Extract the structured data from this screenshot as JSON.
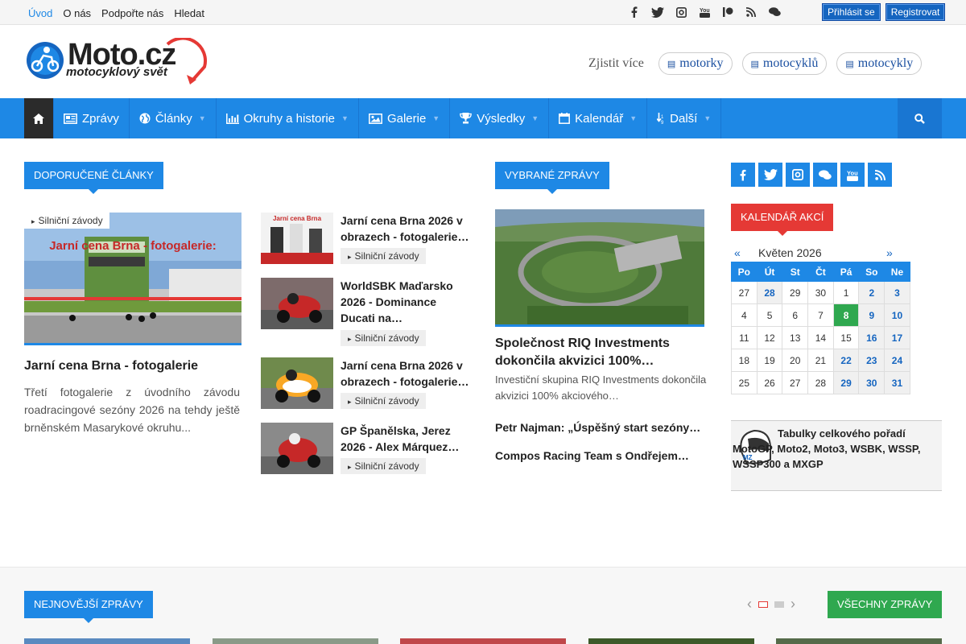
{
  "topbar": {
    "nav": [
      "Úvod",
      "O nás",
      "Podpořte nás",
      "Hledat"
    ],
    "social_icons": [
      "facebook-icon",
      "twitter-icon",
      "instagram-icon",
      "youtube-icon",
      "patreon-icon",
      "rss-icon",
      "forum-icon"
    ],
    "login": "Přihlásit se",
    "register": "Registrovat"
  },
  "header": {
    "logo_text": "Moto.cz",
    "logo_sub": "motocyklový svět",
    "learn_label": "Zjistit více",
    "pills": [
      "motorky",
      "motocyklů",
      "motocykly"
    ]
  },
  "nav": {
    "items": [
      {
        "label": "Zprávy",
        "icon": "newspaper-icon",
        "caret": false
      },
      {
        "label": "Články",
        "icon": "globe-icon",
        "caret": true
      },
      {
        "label": "Okruhy a historie",
        "icon": "bar-chart-icon",
        "caret": true
      },
      {
        "label": "Galerie",
        "icon": "image-icon",
        "caret": true
      },
      {
        "label": "Výsledky",
        "icon": "trophy-icon",
        "caret": true
      },
      {
        "label": "Kalendář",
        "icon": "calendar-icon",
        "caret": true
      },
      {
        "label": "Další",
        "icon": "sort-icon",
        "caret": true
      }
    ]
  },
  "featured": {
    "section_title": "DOPORUČENÉ ČLÁNKY",
    "main": {
      "tag": "Silniční závody",
      "image_caption": "Jarní cena Brna - fotogalerie:",
      "title": "Jarní cena Brna - fotogalerie",
      "excerpt": "Třetí fotogalerie z úvodního závodu roadracingové sezóny 2026 na tehdy ještě brněnském Masarykové okruhu..."
    },
    "side": [
      {
        "title": "Jarní cena Brna 2026 v obrazech - fotogalerie…",
        "tag": "Silniční závody",
        "thumb_caption": "Jarní cena Brna"
      },
      {
        "title": "WorldSBK Maďarsko 2026 - Dominance Ducati na…",
        "tag": "Silniční závody"
      },
      {
        "title": "Jarní cena Brna 2026 v obrazech - fotogalerie…",
        "tag": "Silniční závody"
      },
      {
        "title": "GP Španělska, Jerez 2026 - Alex Márquez…",
        "tag": "Silniční závody"
      }
    ]
  },
  "selected": {
    "section_title": "VYBRANÉ ZPRÁVY",
    "main_title": "Společnost RIQ Investments dokončila akvizici 100%…",
    "main_text": "Investiční skupina RIQ Investments dokončila akvizici 100% akciového…",
    "links": [
      "Petr Najman: „Úspěšný start sezóny…",
      "Compos Racing Team s Ondřejem…"
    ]
  },
  "sidebar": {
    "social_icons": [
      "facebook-icon",
      "twitter-icon",
      "instagram-icon",
      "forum-icon",
      "youtube-icon",
      "rss-icon"
    ],
    "calendar_title": "KALENDÁŘ AKCÍ",
    "prev": "«",
    "month": "Květen 2026",
    "next": "»",
    "weekdays": [
      "Po",
      "Út",
      "St",
      "Čt",
      "Pá",
      "So",
      "Ne"
    ],
    "weeks": [
      [
        "27",
        "28",
        "29",
        "30",
        "1",
        "2",
        "3"
      ],
      [
        "4",
        "5",
        "6",
        "7",
        "8",
        "9",
        "10"
      ],
      [
        "11",
        "12",
        "13",
        "14",
        "15",
        "16",
        "17"
      ],
      [
        "18",
        "19",
        "20",
        "21",
        "22",
        "23",
        "24"
      ],
      [
        "25",
        "26",
        "27",
        "28",
        "29",
        "30",
        "31"
      ]
    ],
    "event_days": [
      "0-1",
      "0-5",
      "0-6",
      "1-5",
      "1-6",
      "2-5",
      "2-6",
      "3-4",
      "3-5",
      "3-6",
      "4-4",
      "4-5",
      "4-6"
    ],
    "today": "1-4",
    "tables_text": "Tabulky celkového pořadí MotoGP, Moto2, Moto3, WSBK, WSSP, WSSP300 a MXGP"
  },
  "latest": {
    "section_title": "NEJNOVĚJŠÍ ZPRÁVY",
    "all_news": "VŠECHNY ZPRÁVY",
    "prev": "‹",
    "next": "›"
  },
  "colors": {
    "accent": "#1e88e5",
    "red": "#e53935",
    "green": "#2fa84f",
    "dark": "#2b2b2b"
  }
}
